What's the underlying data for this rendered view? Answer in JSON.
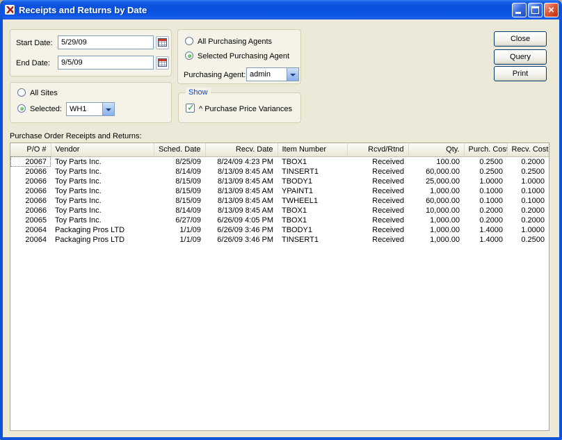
{
  "window": {
    "title": "Receipts and Returns by Date",
    "close_glyph": "×"
  },
  "filters": {
    "start_date": {
      "label": "Start Date:",
      "value": "5/29/09"
    },
    "end_date": {
      "label": "End Date:",
      "value": "9/5/09"
    },
    "agents": {
      "all_label": "All Purchasing Agents",
      "selected_label": "Selected Purchasing Agent",
      "field_label": "Purchasing Agent:",
      "value": "admin"
    },
    "sites": {
      "all_label": "All Sites",
      "selected_label": "Selected:",
      "value": "WH1"
    },
    "show": {
      "caption": "Show",
      "option_label": "^ Purchase Price Variances",
      "checked": true
    }
  },
  "buttons": {
    "close": "Close",
    "query": "Query",
    "print": "Print"
  },
  "table": {
    "caption": "Purchase Order Receipts and Returns:",
    "columns": [
      "P/O #",
      "Vendor",
      "Sched. Date",
      "Recv. Date",
      "Item Number",
      "Rcvd/Rtnd",
      "Qty.",
      "Purch. Cost",
      "Recv. Cost"
    ],
    "rows": [
      [
        "20067",
        "Toy Parts Inc.",
        "8/25/09",
        "8/24/09 4:23 PM",
        "TBOX1",
        "Received",
        "100.00",
        "0.2500",
        "0.2000"
      ],
      [
        "20066",
        "Toy Parts Inc.",
        "8/14/09",
        "8/13/09 8:45 AM",
        "TINSERT1",
        "Received",
        "60,000.00",
        "0.2500",
        "0.2500"
      ],
      [
        "20066",
        "Toy Parts Inc.",
        "8/15/09",
        "8/13/09 8:45 AM",
        "TBODY1",
        "Received",
        "25,000.00",
        "1.0000",
        "1.0000"
      ],
      [
        "20066",
        "Toy Parts Inc.",
        "8/15/09",
        "8/13/09 8:45 AM",
        "YPAINT1",
        "Received",
        "1,000.00",
        "0.1000",
        "0.1000"
      ],
      [
        "20066",
        "Toy Parts Inc.",
        "8/15/09",
        "8/13/09 8:45 AM",
        "TWHEEL1",
        "Received",
        "60,000.00",
        "0.1000",
        "0.1000"
      ],
      [
        "20066",
        "Toy Parts Inc.",
        "8/14/09",
        "8/13/09 8:45 AM",
        "TBOX1",
        "Received",
        "10,000.00",
        "0.2000",
        "0.2000"
      ],
      [
        "20065",
        "Toy Parts Inc.",
        "6/27/09",
        "6/26/09 4:05 PM",
        "TBOX1",
        "Received",
        "1,000.00",
        "0.2000",
        "0.2000"
      ],
      [
        "20064",
        "Packaging Pros LTD",
        "1/1/09",
        "6/26/09 3:46 PM",
        "TBODY1",
        "Received",
        "1,000.00",
        "1.4000",
        "1.0000"
      ],
      [
        "20064",
        "Packaging Pros LTD",
        "1/1/09",
        "6/26/09 3:46 PM",
        "TINSERT1",
        "Received",
        "1,000.00",
        "1.4000",
        "0.2500"
      ]
    ]
  }
}
